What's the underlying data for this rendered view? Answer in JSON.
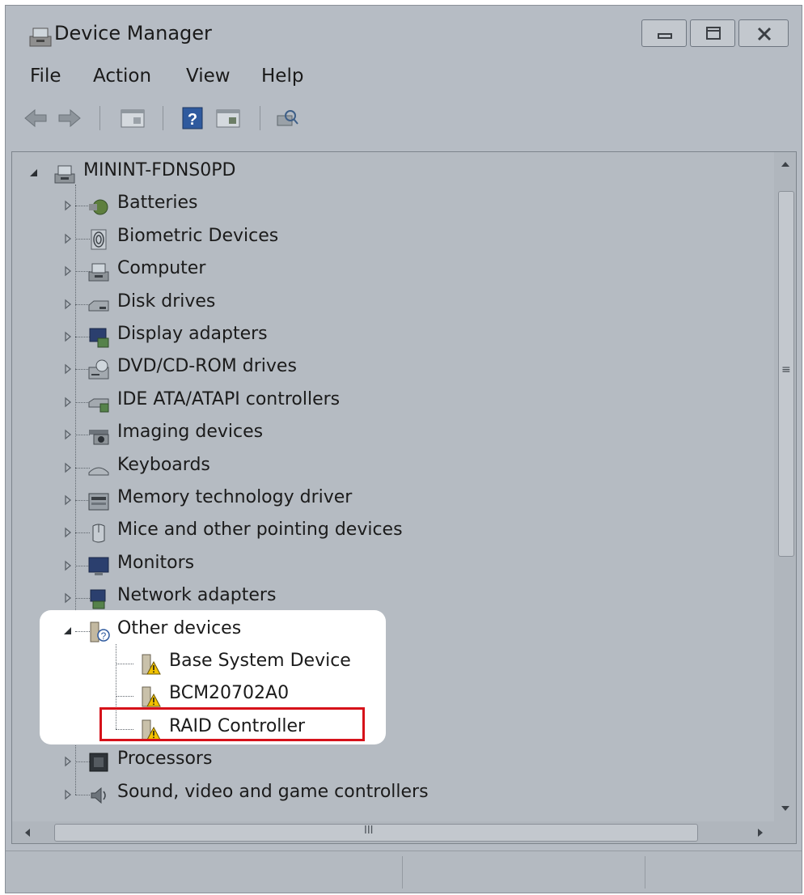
{
  "window": {
    "title": "Device Manager"
  },
  "menu": [
    "File",
    "Action",
    "View",
    "Help"
  ],
  "toolbar": {
    "buttons": [
      "back-arrow-icon",
      "forward-arrow-icon",
      "properties-icon",
      "help-icon",
      "update-driver-icon",
      "scan-hardware-icon"
    ]
  },
  "tree": {
    "root": {
      "label": "MININT-FDNS0PD",
      "icon": "computer-icon",
      "expanded": true
    },
    "categories": [
      {
        "label": "Batteries",
        "icon": "battery-icon"
      },
      {
        "label": "Biometric Devices",
        "icon": "fingerprint-icon"
      },
      {
        "label": "Computer",
        "icon": "computer-icon"
      },
      {
        "label": "Disk drives",
        "icon": "disk-drive-icon"
      },
      {
        "label": "Display adapters",
        "icon": "display-adapter-icon"
      },
      {
        "label": "DVD/CD-ROM drives",
        "icon": "dvd-drive-icon"
      },
      {
        "label": "IDE ATA/ATAPI controllers",
        "icon": "ide-controller-icon"
      },
      {
        "label": "Imaging devices",
        "icon": "camera-icon"
      },
      {
        "label": "Keyboards",
        "icon": "keyboard-icon"
      },
      {
        "label": "Memory technology driver",
        "icon": "memory-icon"
      },
      {
        "label": "Mice and other pointing devices",
        "icon": "mouse-icon"
      },
      {
        "label": "Monitors",
        "icon": "monitor-icon"
      },
      {
        "label": "Network adapters",
        "icon": "network-icon"
      },
      {
        "label": "Other devices",
        "icon": "unknown-device-icon",
        "expanded": true,
        "children": [
          {
            "label": "Base System Device",
            "icon": "warning-device-icon"
          },
          {
            "label": "BCM20702A0",
            "icon": "warning-device-icon"
          },
          {
            "label": "RAID Controller",
            "icon": "warning-device-icon",
            "highlighted": true
          }
        ]
      },
      {
        "label": "Processors",
        "icon": "processor-icon"
      },
      {
        "label": "Sound, video and game controllers",
        "icon": "speaker-icon"
      }
    ]
  },
  "scrollbar": {
    "h_grip": "III",
    "v_grip": "≡"
  },
  "colors": {
    "dim_background": "#b6bcc4",
    "highlight": "#ffffff",
    "callout_border": "#d6121a",
    "warning": "#f2c200"
  }
}
